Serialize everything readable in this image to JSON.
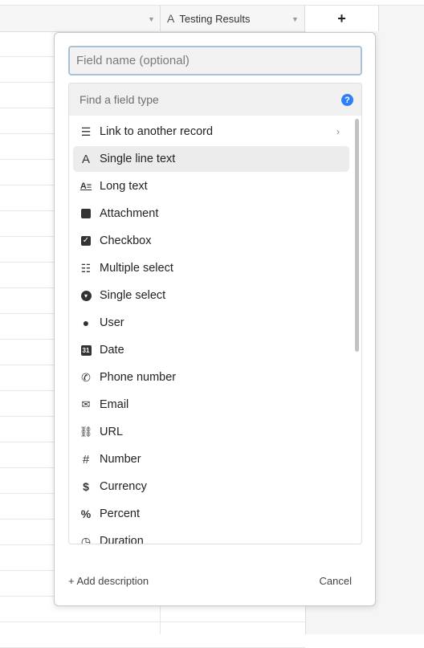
{
  "header": {
    "column_name": "Testing Results",
    "column_type_icon": "A",
    "add_column_symbol": "+"
  },
  "popover": {
    "field_name_placeholder": "Field name (optional)",
    "search_placeholder": "Find a field type",
    "help_symbol": "?",
    "field_types": [
      {
        "label": "Link to another record",
        "icon": "link-record-icon",
        "has_submenu": true
      },
      {
        "label": "Single line text",
        "icon": "text-a-icon",
        "selected": true
      },
      {
        "label": "Long text",
        "icon": "long-text-icon"
      },
      {
        "label": "Attachment",
        "icon": "file-icon"
      },
      {
        "label": "Checkbox",
        "icon": "checkbox-icon"
      },
      {
        "label": "Multiple select",
        "icon": "multi-select-icon"
      },
      {
        "label": "Single select",
        "icon": "single-select-icon"
      },
      {
        "label": "User",
        "icon": "user-icon"
      },
      {
        "label": "Date",
        "icon": "calendar-icon"
      },
      {
        "label": "Phone number",
        "icon": "phone-icon"
      },
      {
        "label": "Email",
        "icon": "envelope-icon"
      },
      {
        "label": "URL",
        "icon": "url-link-icon"
      },
      {
        "label": "Number",
        "icon": "hash-icon"
      },
      {
        "label": "Currency",
        "icon": "dollar-icon"
      },
      {
        "label": "Percent",
        "icon": "percent-icon"
      },
      {
        "label": "Duration",
        "icon": "clock-icon"
      }
    ],
    "add_description_label": "+ Add description",
    "cancel_label": "Cancel"
  }
}
